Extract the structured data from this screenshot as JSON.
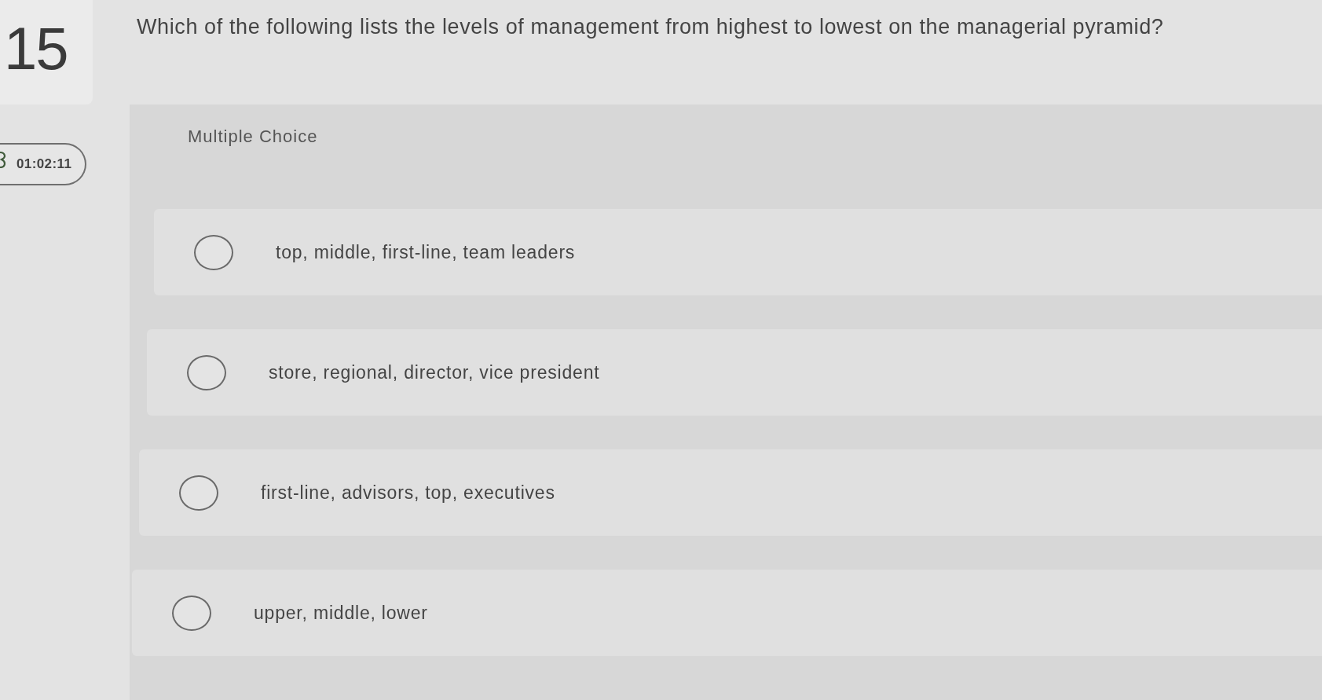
{
  "question": {
    "number": "15",
    "timer": "01:02:11",
    "text": "Which of the following lists the levels of management from highest to lowest on the managerial pyramid?"
  },
  "answer": {
    "type_label": "Multiple Choice",
    "options": [
      {
        "label": "top, middle, first-line, team leaders",
        "selected": false
      },
      {
        "label": "store, regional, director, vice president",
        "selected": false
      },
      {
        "label": "first-line, advisors, top, executives",
        "selected": false
      },
      {
        "label": "upper, middle, lower",
        "selected": false
      }
    ]
  }
}
